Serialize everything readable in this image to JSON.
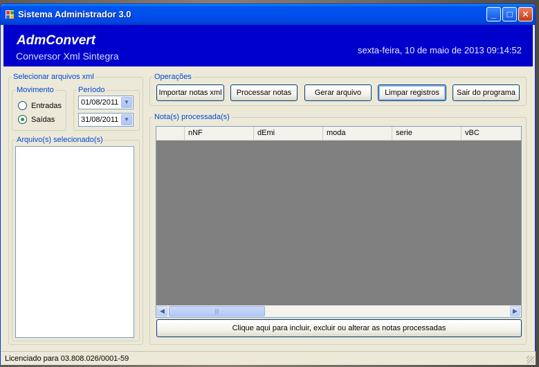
{
  "window": {
    "title": "Sistema Administrador 3.0",
    "minimize_glyph": "_",
    "maximize_glyph": "□",
    "close_glyph": "✕"
  },
  "header": {
    "app_name": "AdmConvert",
    "subtitle": "Conversor Xml Sintegra",
    "datetime": "sexta-feira, 10 de maio de 2013 09:14:52"
  },
  "select_files": {
    "legend": "Selecionar arquivos xml",
    "movimento": {
      "legend": "Movimento",
      "options": [
        {
          "label": "Entradas",
          "checked": false
        },
        {
          "label": "Saídas",
          "checked": true
        }
      ]
    },
    "periodo": {
      "legend": "Período",
      "start": "01/08/2011",
      "end": "31/08/2011"
    },
    "selected_files": {
      "legend": "Arquivo(s) selecionado(s)",
      "items": []
    }
  },
  "operations": {
    "legend": "Operações",
    "buttons": {
      "import": "Importar notas xml",
      "process": "Processar notas",
      "generate": "Gerar arquivo",
      "clear": "Limpar registros",
      "exit": "Sair do programa"
    }
  },
  "processed": {
    "legend": "Nota(s) processada(s)",
    "columns": [
      "nNF",
      "dEmi",
      "moda",
      "serie",
      "vBC"
    ],
    "rows": [],
    "edit_button": "Clique aqui para incluir,  excluir ou alterar as notas processadas"
  },
  "status_bar": {
    "text": "Licenciado para 03.808.026/0001-59"
  },
  "colors": {
    "header_bg": "#0000cd",
    "titlebar": "#0050ee",
    "legend": "#0046d5",
    "grid_bg": "#808080"
  }
}
